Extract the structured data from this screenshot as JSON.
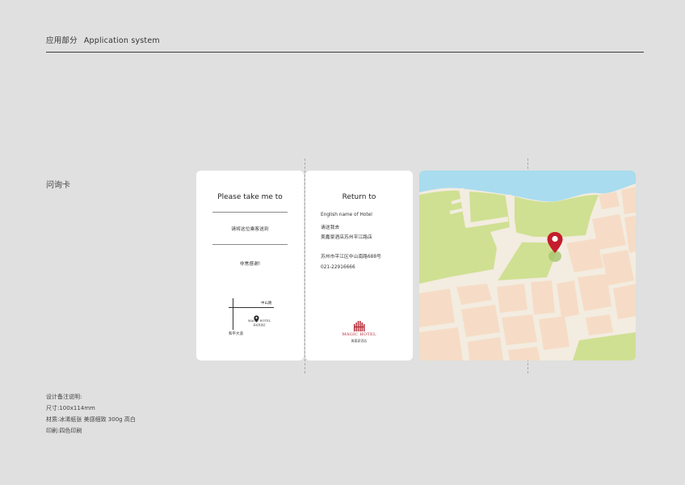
{
  "header": {
    "title_cn": "应用部分",
    "title_en": "Application system"
  },
  "section": {
    "label": "问询卡"
  },
  "card_left": {
    "title": "Please take me to",
    "line1": "请将这位乘客送到",
    "line2": "非常感谢!",
    "map_road1": "中山路",
    "map_road2": "和平大道",
    "map_brand_en": "MAGIC HOTEL",
    "map_brand_cn": "美嘉豪酒店"
  },
  "card_mid": {
    "title": "Return to",
    "hotel_en": "English name of Hotel",
    "line1": "请送我去",
    "line2": "美嘉豪酒店苏州平江路店",
    "address": "苏州市平江区中山南路688号",
    "phone": "021-22916666",
    "logo_en": "MAGIC HOTEL",
    "logo_cn": "美嘉豪酒店"
  },
  "notes": {
    "heading": "设计备注说明:",
    "size": "尺寸:100x114mm",
    "material": "材质:冰浠纸张 美感细致 300g 高白",
    "print": "印刷:四色印刷"
  },
  "colors": {
    "background": "#dfe0df",
    "card": "#ffffff",
    "map_water": "#a9dcee",
    "map_park": "#cfe092",
    "map_block": "#f6dcc6",
    "map_road": "#f3ece0",
    "pin": "#c41d2c",
    "brand": "#b0222f"
  }
}
